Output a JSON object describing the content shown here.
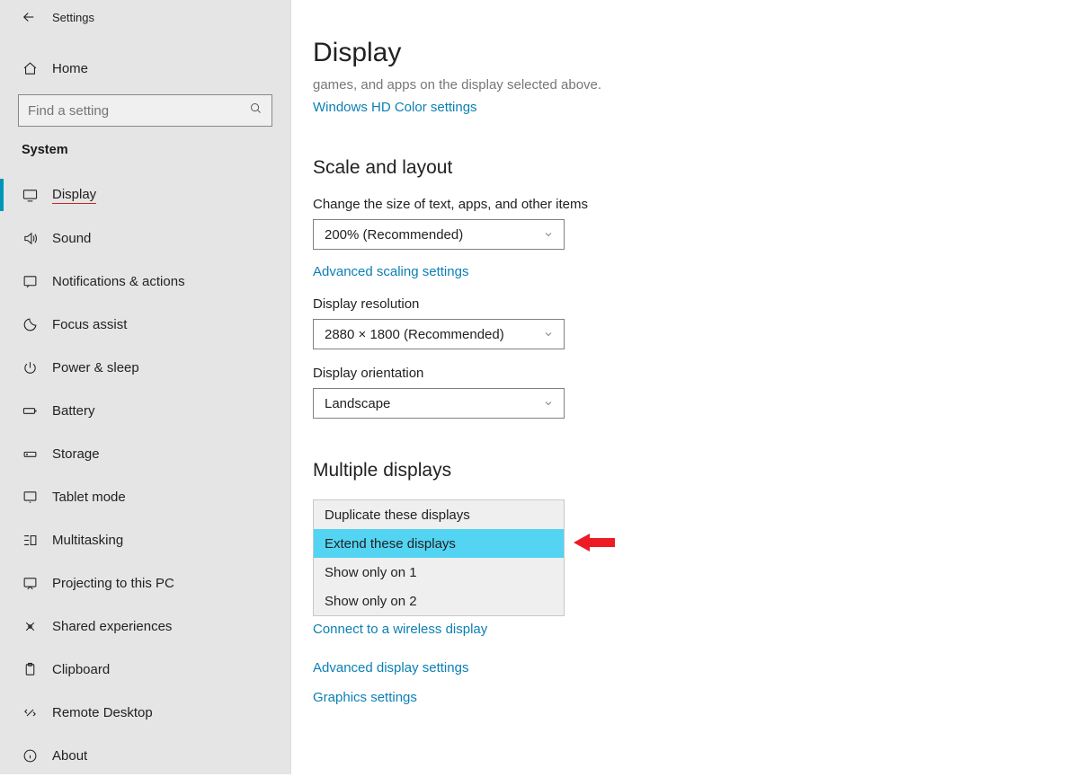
{
  "header": {
    "settings_label": "Settings"
  },
  "home": {
    "label": "Home"
  },
  "search": {
    "placeholder": "Find a setting"
  },
  "category": {
    "label": "System"
  },
  "nav": {
    "items": [
      {
        "label": "Display"
      },
      {
        "label": "Sound"
      },
      {
        "label": "Notifications & actions"
      },
      {
        "label": "Focus assist"
      },
      {
        "label": "Power & sleep"
      },
      {
        "label": "Battery"
      },
      {
        "label": "Storage"
      },
      {
        "label": "Tablet mode"
      },
      {
        "label": "Multitasking"
      },
      {
        "label": "Projecting to this PC"
      },
      {
        "label": "Shared experiences"
      },
      {
        "label": "Clipboard"
      },
      {
        "label": "Remote Desktop"
      },
      {
        "label": "About"
      }
    ]
  },
  "page": {
    "title": "Display",
    "subdesc": "games, and apps on the display selected above.",
    "hdcolor_link": "Windows HD Color settings"
  },
  "scale": {
    "heading": "Scale and layout",
    "size_label": "Change the size of text, apps, and other items",
    "size_value": "200% (Recommended)",
    "advanced_link": "Advanced scaling settings",
    "res_label": "Display resolution",
    "res_value": "2880 × 1800 (Recommended)",
    "orient_label": "Display orientation",
    "orient_value": "Landscape"
  },
  "multiple": {
    "heading": "Multiple displays",
    "options": [
      {
        "label": "Duplicate these displays"
      },
      {
        "label": "Extend these displays"
      },
      {
        "label": "Show only on 1"
      },
      {
        "label": "Show only on 2"
      }
    ],
    "connect_link": "Connect to a wireless display",
    "adv_display_link": "Advanced display settings",
    "graphics_link": "Graphics settings"
  }
}
